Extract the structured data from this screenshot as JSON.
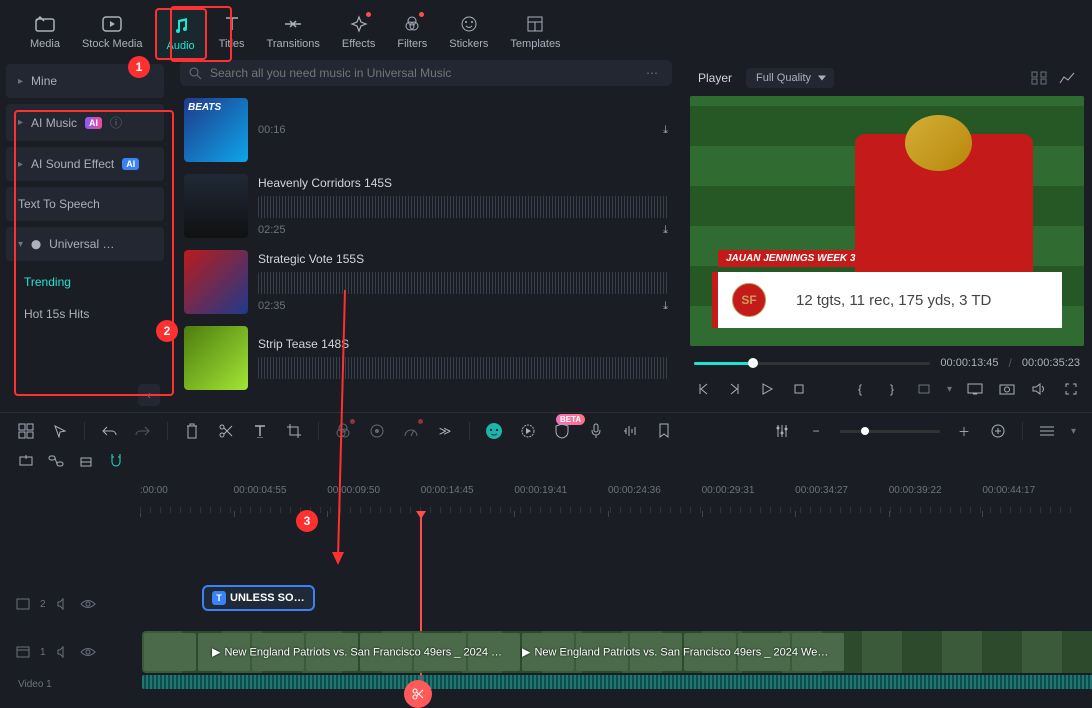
{
  "tabs": {
    "media": "Media",
    "stock_media": "Stock Media",
    "audio": "Audio",
    "titles": "Titles",
    "transitions": "Transitions",
    "effects": "Effects",
    "filters": "Filters",
    "stickers": "Stickers",
    "templates": "Templates"
  },
  "sidebar": {
    "mine": "Mine",
    "ai_music": "AI Music",
    "ai_sound_effect": "AI Sound Effect",
    "text_to_speech": "Text To Speech",
    "universal": "Universal …",
    "trending": "Trending",
    "hot15": "Hot 15s Hits",
    "ai_badge": "AI",
    "ai_badge2": "AI"
  },
  "search": {
    "placeholder": "Search all you need music in Universal Music"
  },
  "music": {
    "item0": {
      "duration": "00:16"
    },
    "item1": {
      "title": "Heavenly Corridors 145S",
      "duration": "02:25"
    },
    "item2": {
      "title": "Strategic Vote 155S",
      "duration": "02:35"
    },
    "item3": {
      "title": "Strip Tease 148S"
    }
  },
  "player": {
    "label": "Player",
    "quality": "Full Quality",
    "current": "00:00:13:45",
    "total": "00:00:35:23",
    "overlay_header": "JAUAN JENNINGS WEEK 3",
    "overlay_text": "12 tgts, 11 rec, 175 yds, 3 TD",
    "logo": "SF"
  },
  "timeline": {
    "ticks": [
      ":00:00",
      "00:00:04:55",
      "00:00:09:50",
      "00:00:14:45",
      "00:00:19:41",
      "00:00:24:36",
      "00:00:29:31",
      "00:00:34:27",
      "00:00:39:22",
      "00:00:44:17"
    ],
    "track2_label": "2",
    "track1_label": "1",
    "video_label": "Video 1",
    "text_clip": "UNLESS SO…",
    "clip_a": "New England Patriots vs. San Francisco 49ers _ 2024 …",
    "clip_b": "New England Patriots vs. San Francisco 49ers _ 2024 We…",
    "beta": "BETA"
  },
  "annotations": {
    "a1": "1",
    "a2": "2",
    "a3": "3"
  }
}
